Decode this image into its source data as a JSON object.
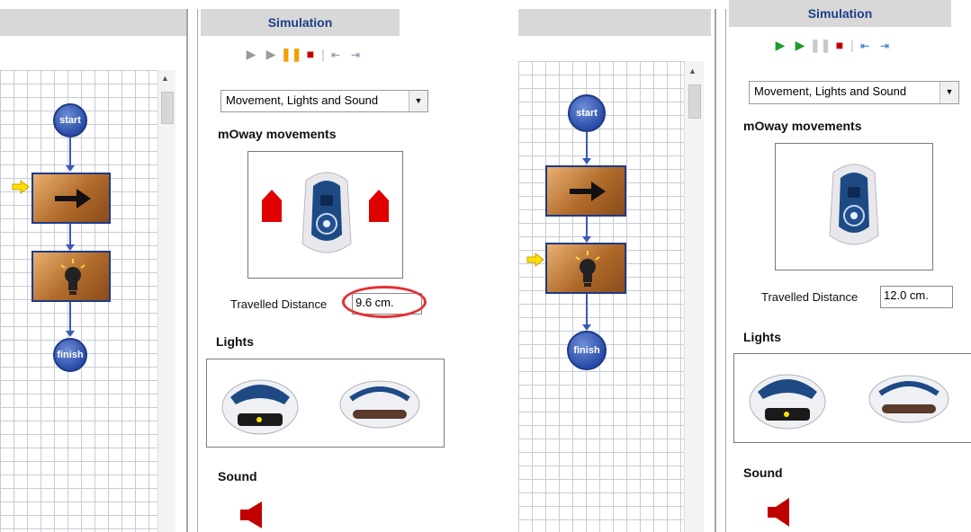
{
  "simulation_title": "Simulation",
  "left": {
    "dropdown_value": "Movement, Lights and Sound",
    "movements_title": "mOway movements",
    "distance_label": "Travelled Distance",
    "distance_value": "9.6 cm.",
    "lights_title": "Lights",
    "sound_title": "Sound",
    "node_start": "start",
    "node_finish": "finish"
  },
  "right": {
    "dropdown_value": "Movement, Lights and Sound",
    "movements_title": "mOway movements",
    "distance_label": "Travelled Distance",
    "distance_value": "12.0 cm.",
    "lights_title": "Lights",
    "sound_title": "Sound",
    "node_start": "start",
    "node_finish": "finish"
  },
  "toolbar_icons": [
    "play-icon",
    "step-icon",
    "pause-icon",
    "stop-icon",
    "step-into-icon",
    "step-over-icon"
  ],
  "colors": {
    "title_blue": "#1f3f8a",
    "highlight_red": "#e53030",
    "pointer_yellow": "#ffe000",
    "robot_blue": "#1e4a84"
  }
}
